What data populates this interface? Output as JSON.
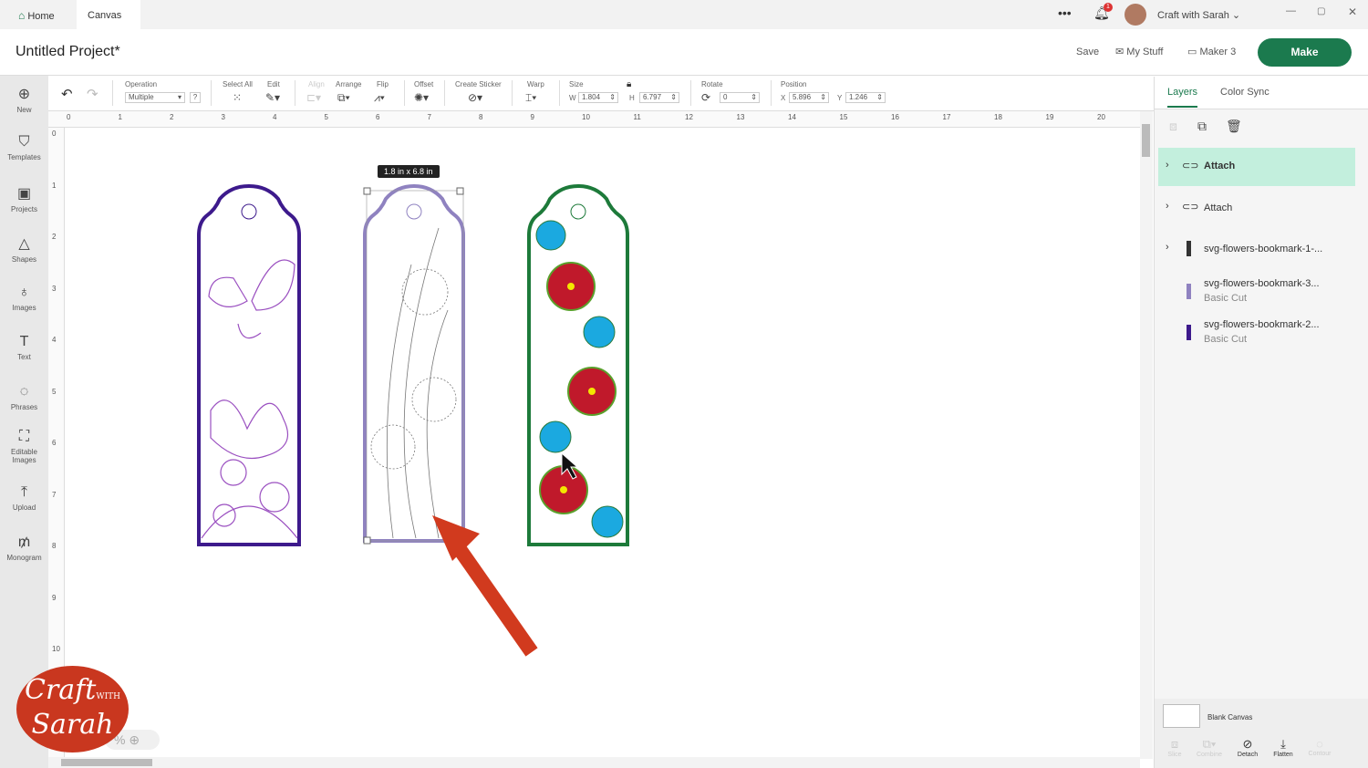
{
  "topbar": {
    "tabs": [
      "Home",
      "Canvas"
    ],
    "notif_count": "1",
    "user": "Craft with Sarah"
  },
  "header": {
    "title": "Untitled Project*",
    "save": "Save",
    "mystuff": "My Stuff",
    "machine": "Maker 3",
    "make": "Make"
  },
  "sidebar": [
    "New",
    "Templates",
    "Projects",
    "Shapes",
    "Images",
    "Text",
    "Phrases",
    "Editable Images",
    "Upload",
    "Monogram"
  ],
  "toolbar": {
    "operation_label": "Operation",
    "operation_value": "Multiple",
    "select_all": "Select All",
    "edit": "Edit",
    "align": "Align",
    "arrange": "Arrange",
    "flip": "Flip",
    "offset": "Offset",
    "create_sticker": "Create Sticker",
    "warp": "Warp",
    "size": "Size",
    "w_label": "W",
    "w": "1.804",
    "h_label": "H",
    "h": "6.797",
    "rotate": "Rotate",
    "rotate_value": "0",
    "position": "Position",
    "x_label": "X",
    "x": "5.896",
    "y_label": "Y",
    "y": "1.246"
  },
  "ruler": {
    "h": [
      "0",
      "1",
      "2",
      "3",
      "4",
      "5",
      "6",
      "7",
      "8",
      "9",
      "10",
      "11",
      "12",
      "13",
      "14",
      "15",
      "16",
      "17",
      "18",
      "19",
      "20"
    ],
    "v": [
      "0",
      "1",
      "2",
      "3",
      "4",
      "5",
      "6",
      "7",
      "8",
      "9",
      "10"
    ]
  },
  "canvas": {
    "size_tooltip": "1.8  in x 6.8  in",
    "zoom": "%"
  },
  "panel": {
    "tabs": [
      "Layers",
      "Color Sync"
    ],
    "layers": [
      {
        "name": "Attach",
        "sub": ""
      },
      {
        "name": "Attach",
        "sub": ""
      },
      {
        "name": "svg-flowers-bookmark-1-...",
        "sub": ""
      },
      {
        "name": "svg-flowers-bookmark-3...",
        "sub": "Basic Cut"
      },
      {
        "name": "svg-flowers-bookmark-2...",
        "sub": "Basic Cut"
      }
    ],
    "blank_canvas": "Blank Canvas",
    "bottom": [
      "Slice",
      "Combine",
      "Detach",
      "Flatten",
      "Contour"
    ]
  },
  "logo": {
    "line1": "Craft",
    "with": "WITH",
    "line2": "Sarah"
  },
  "colors": {
    "make": "#1b7a4e",
    "selected_layer": "#c3efdd",
    "purple": "#3d1a8c",
    "lavender": "#8f82c0",
    "green": "#1d7a3a",
    "red": "#c0392b"
  }
}
